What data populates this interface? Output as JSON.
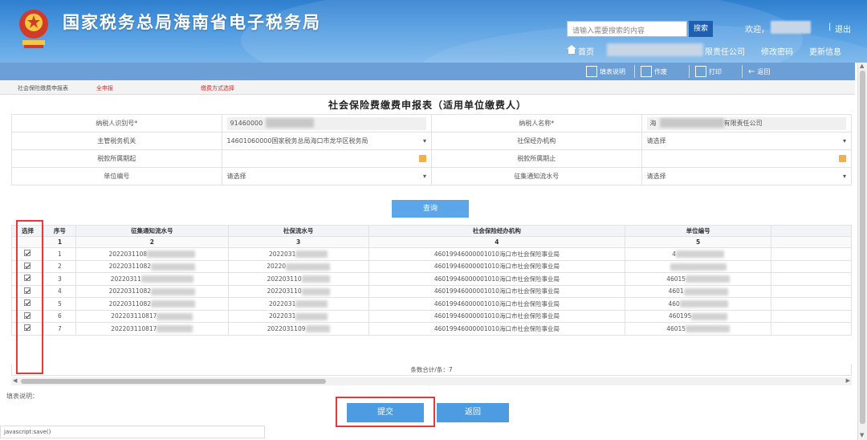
{
  "header": {
    "site_title": "国家税务总局海南省电子税务局",
    "search_placeholder": "请输入需要搜索的内容",
    "search_button": "搜索",
    "welcome": "欢迎，",
    "logout": "退出",
    "home": "首页",
    "company_suffix": "限责任公司",
    "change_password": "修改密码",
    "update_info": "更新信息"
  },
  "toolbar": {
    "guide": "填表说明",
    "reset": "作废",
    "print": "打印",
    "back": "返回"
  },
  "steps": {
    "step1": "社会保险缴费申报表",
    "step2": "全申报",
    "step3": "缴费方式选择"
  },
  "form": {
    "title": "社会保险费缴费申报表（适用单位缴费人）",
    "taxpayer_id_label": "纳税人识别号*",
    "taxpayer_id_value": "91460000",
    "taxpayer_name_label": "纳税人名称*",
    "taxpayer_name_prefix": "海",
    "taxpayer_name_suffix": "有限责任公司",
    "tax_authority_label": "主管税务机关",
    "tax_authority_value": "14601060000国家税务总局海口市龙华区税务局",
    "si_agency_label": "社保经办机构",
    "si_agency_value": "请选择",
    "period_start_label": "税款所属期起",
    "period_end_label": "税款所属期止",
    "unit_no_label": "单位编号",
    "unit_no_value": "请选择",
    "notice_no_label": "征集通知流水号",
    "notice_no_value": "请选择",
    "query_button": "查询"
  },
  "table": {
    "headers": [
      "选择",
      "序号",
      "征集通知流水号",
      "社保流水号",
      "社会保险经办机构",
      "单位编号"
    ],
    "index_row": [
      "1",
      "2",
      "3",
      "4",
      "5"
    ],
    "rows": [
      {
        "seq": "1",
        "notice": "2022031108",
        "si": "2022031",
        "agency": "46019946000001010海口市社会保险事业局",
        "unit": "4"
      },
      {
        "seq": "2",
        "notice": "20220311082",
        "si": "20220",
        "agency": "46019946000001010海口市社会保险事业局",
        "unit": ""
      },
      {
        "seq": "3",
        "notice": "20220311",
        "si": "202203110",
        "agency": "46019946000001010海口市社会保险事业局",
        "unit": "46015"
      },
      {
        "seq": "4",
        "notice": "20220311082",
        "si": "202203110",
        "agency": "46019946000001010海口市社会保险事业局",
        "unit": "4601"
      },
      {
        "seq": "5",
        "notice": "20220311082",
        "si": "2022031",
        "agency": "46019946000001010海口市社会保险事业局",
        "unit": "460"
      },
      {
        "seq": "6",
        "notice": "202203110817",
        "si": "2022031",
        "agency": "46019946000001010海口市社会保险事业局",
        "unit": "460195"
      },
      {
        "seq": "7",
        "notice": "202203110817",
        "si": "2022031109",
        "agency": "46019946000001010海口市社会保险事业局",
        "unit": "46015"
      }
    ],
    "total": "条数合计/条：7"
  },
  "footer": {
    "note_label": "填表说明：",
    "submit_button": "提交",
    "back_button": "返回",
    "status_text": "javascript:save()"
  },
  "colors": {
    "header_blue": "#2f7fd0",
    "button_blue": "#4d9be0",
    "highlight_red": "#e53a3a"
  }
}
